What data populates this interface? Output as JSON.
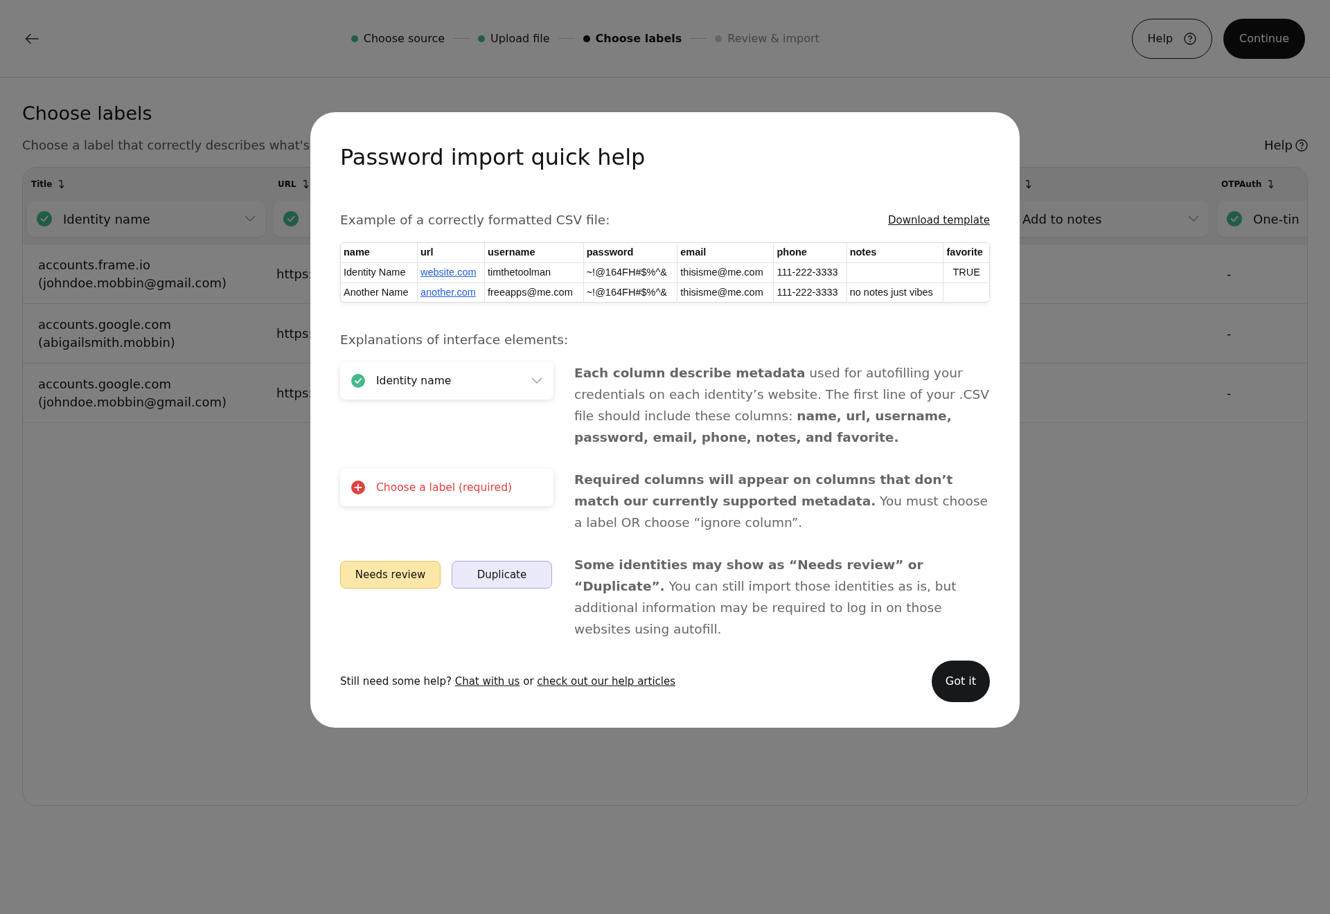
{
  "top_bar": {
    "steps": [
      {
        "label": "Choose source",
        "completed": true,
        "selected": false
      },
      {
        "label": "Upload file",
        "completed": true,
        "selected": false
      },
      {
        "label": "Choose labels",
        "selected": true
      },
      {
        "label": "Review & import",
        "completed": false,
        "selected": false
      }
    ],
    "help_button": "Help",
    "continue_button": "Continue"
  },
  "page": {
    "title": "Choose labels",
    "subtitle": "Choose a label that correctly describes what's",
    "help_link": "Help"
  },
  "table": {
    "columns": [
      {
        "header": "Title",
        "dropdown": "Identity name",
        "matched": true
      },
      {
        "header": "URL",
        "matched": true
      },
      {
        "dropdown": "Add to notes"
      },
      {
        "header": "OTPAuth",
        "dropdown": "One-tin",
        "matched": true
      }
    ],
    "rows": [
      {
        "title": [
          "accounts.frame.io",
          "(johndoe.mobbin@gmail.com)"
        ],
        "url": "https:",
        "otpauth": "-"
      },
      {
        "title": [
          "accounts.google.com",
          "(abigailsmith.mobbin)"
        ],
        "url": "https:",
        "otpauth": "-"
      },
      {
        "title": [
          "accounts.google.com",
          "(johndoe.mobbin@gmail.com)"
        ],
        "url": "https:",
        "otpauth": "-"
      }
    ]
  },
  "modal": {
    "title": "Password import quick help",
    "example_label": "Example of a correctly formatted CSV file:",
    "download_link": "Download template",
    "csv": {
      "columns": [
        {
          "name": "name",
          "kind": "text"
        },
        {
          "name": "url",
          "kind": "link"
        },
        {
          "name": "username",
          "kind": "text"
        },
        {
          "name": "password",
          "kind": "text"
        },
        {
          "name": "email",
          "kind": "text"
        },
        {
          "name": "phone",
          "kind": "text"
        },
        {
          "name": "notes",
          "kind": "text"
        },
        {
          "name": "favorite",
          "kind": "center"
        }
      ],
      "rows": [
        [
          "Identity Name",
          "website.com",
          "timthetoolman",
          "~!@164FH#$%^&",
          "thisisme@me.com",
          "111-222-3333",
          "",
          "TRUE"
        ],
        [
          "Another Name",
          "another.com",
          "freeapps@me.com",
          "~!@164FH#$%^&",
          "thisisme@me.com",
          "111-222-3333",
          "no notes just vibes",
          ""
        ]
      ]
    },
    "explanations_label": "Explanations of interface elements:",
    "explanations": [
      {
        "kind": "dropdown",
        "sample": {
          "label": "Identity name",
          "valid": true
        },
        "text": "**Each column describe metadata** used for autofilling your credentials on each identity’s website. The first line of your .CSV file should include these columns: **name, url, username, password, email, phone, notes, and favorite.**"
      },
      {
        "kind": "dropdown",
        "sample": {
          "label": "Choose a label (required)",
          "valid": false
        },
        "text": "**Required columns will appear on columns that don’t match our currently supported metadata.** You must choose a label OR choose “ignore column”."
      },
      {
        "kind": "badges",
        "badges": [
          {
            "label": "Needs review",
            "color": "#fbe8a8"
          },
          {
            "label": "Duplicate",
            "color": "#ebeafb"
          }
        ],
        "text": "**Some identities may show as “Needs review” or “Duplicate”.** You can still import those identities as is, but additional information may be required to log in on those websites using autofill."
      }
    ],
    "help_sentence": [
      {
        "text": "Still need some help? ",
        "kind": "text"
      },
      {
        "text": "Chat with us",
        "kind": "link"
      },
      {
        "text": " or ",
        "kind": "text"
      },
      {
        "text": "check out our help articles",
        "kind": "link"
      }
    ],
    "got_it_button": "Got it"
  }
}
